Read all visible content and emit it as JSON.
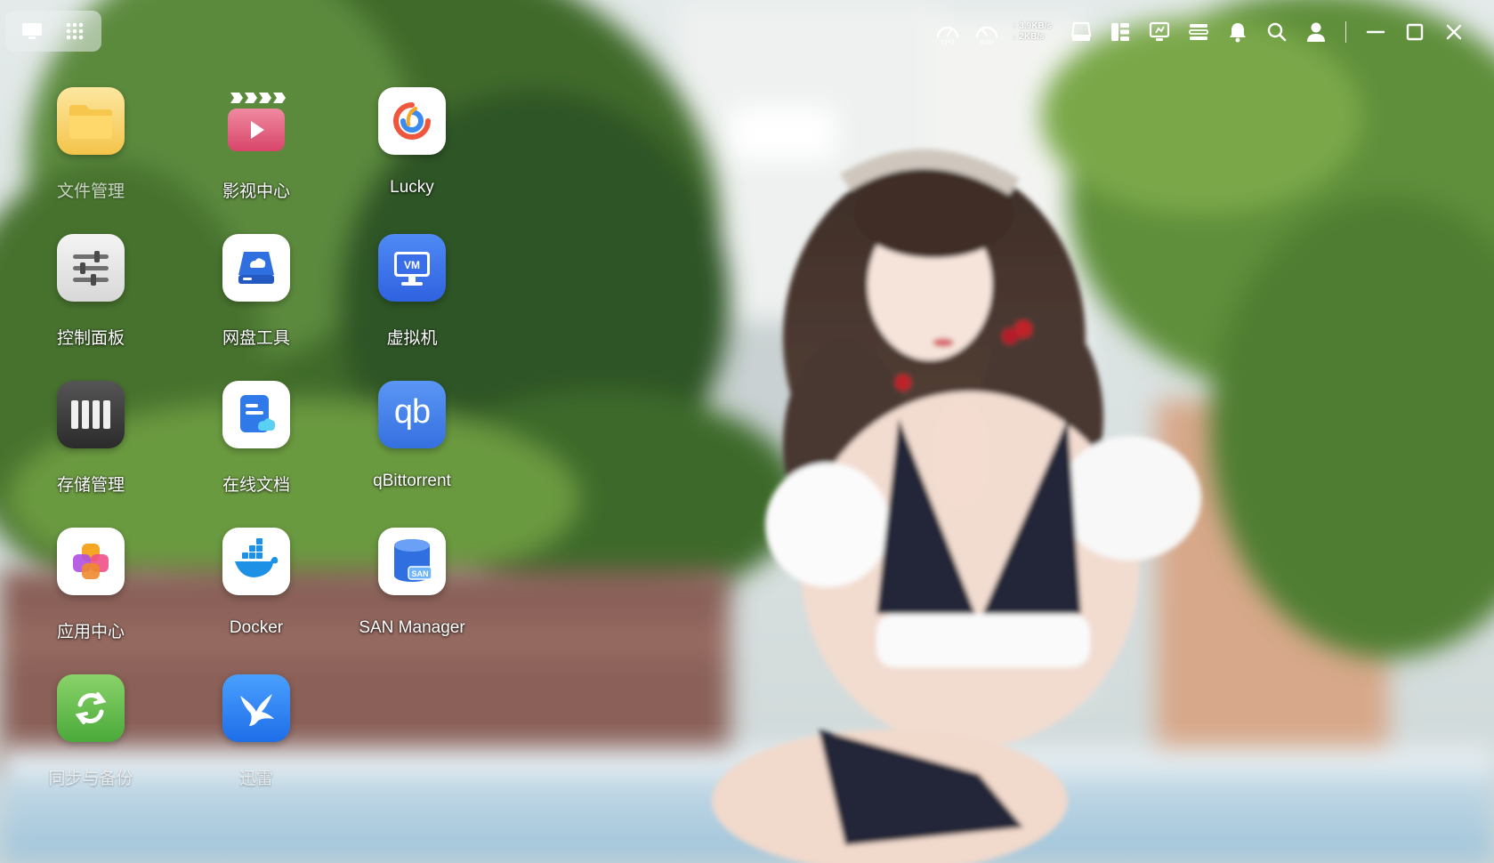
{
  "launcher": {
    "icons": [
      "desktop-icon",
      "app-grid-icon"
    ]
  },
  "statusbar": {
    "cpu_label": "CPU",
    "ram_label": "RAM",
    "upload": "↑ 3.9KB/s",
    "download": "↓ 2KB/s",
    "icons": [
      "cpu-gauge-icon",
      "ram-gauge-icon",
      "drive-icon",
      "panel-layout-icon",
      "monitor-icon",
      "task-list-icon",
      "bell-icon",
      "search-icon",
      "user-icon",
      "minimize-icon",
      "maximize-icon",
      "close-icon"
    ]
  },
  "apps": [
    {
      "id": "file-manager",
      "label": "文件管理",
      "icon": "folder-icon",
      "faded": true
    },
    {
      "id": "video-center",
      "label": "影视中心",
      "icon": "clapperboard-icon"
    },
    {
      "id": "lucky",
      "label": "Lucky",
      "icon": "lucky-swirl-icon"
    },
    {
      "id": "control-panel",
      "label": "控制面板",
      "icon": "sliders-icon"
    },
    {
      "id": "cloud-drive-tool",
      "label": "网盘工具",
      "icon": "cloud-drive-icon"
    },
    {
      "id": "virtual-machine",
      "label": "虚拟机",
      "icon": "vm-monitor-icon",
      "badge": "VM"
    },
    {
      "id": "storage-manager",
      "label": "存储管理",
      "icon": "disk-array-icon"
    },
    {
      "id": "online-docs",
      "label": "在线文档",
      "icon": "document-cloud-icon"
    },
    {
      "id": "qbittorrent",
      "label": "qBittorrent",
      "icon": "qb-icon",
      "badge": "qb"
    },
    {
      "id": "app-center",
      "label": "应用中心",
      "icon": "app-blocks-icon"
    },
    {
      "id": "docker",
      "label": "Docker",
      "icon": "docker-whale-icon"
    },
    {
      "id": "san-manager",
      "label": "SAN Manager",
      "icon": "san-database-icon",
      "badge": "SAN"
    },
    {
      "id": "sync-backup",
      "label": "同步与备份",
      "icon": "sync-arrows-icon",
      "faded": true
    },
    {
      "id": "xunlei",
      "label": "迅雷",
      "icon": "bird-icon",
      "faded": true
    }
  ]
}
